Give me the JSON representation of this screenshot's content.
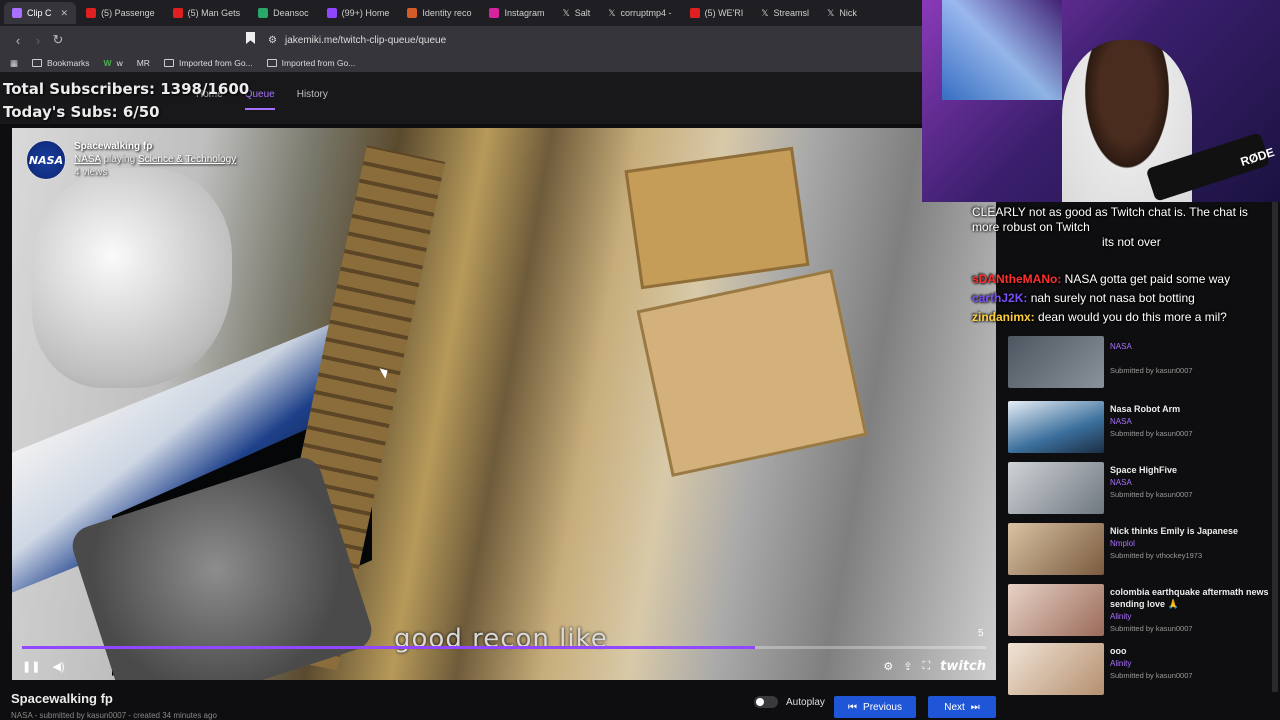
{
  "browser": {
    "tabs": [
      {
        "label": "Clip C",
        "color": "#a970ff",
        "active": true
      },
      {
        "label": "(5) Passenge",
        "color": "#e02020"
      },
      {
        "label": "(5) Man Gets",
        "color": "#e02020"
      },
      {
        "label": "Deansoc",
        "color": "#2aa86b"
      },
      {
        "label": "(99+) Home",
        "color": "#9146ff"
      },
      {
        "label": "Identity reco",
        "color": "#d45d2a"
      },
      {
        "label": "Instagram",
        "color": "#d6249f"
      },
      {
        "label": "Salt",
        "color": "#ffffff"
      },
      {
        "label": "corruptmp4 -",
        "color": "#ffffff"
      },
      {
        "label": "(5) WE'RI",
        "color": "#e02020"
      },
      {
        "label": "Streamsl",
        "color": "#ffffff"
      },
      {
        "label": "Nick",
        "color": "#ffffff"
      }
    ],
    "url": "jakemiki.me/twitch-clip-queue/queue",
    "bookmarks": [
      "Bookmarks",
      "w",
      "MR",
      "Imported from Go...",
      "Imported from Go..."
    ]
  },
  "overlay": {
    "total_subs": "Total Subscribers: 1398/1600",
    "today_subs": "Today's Subs: 6/50"
  },
  "site": {
    "nav": [
      "Home",
      "Queue",
      "History"
    ]
  },
  "player": {
    "clip_title": "Spacewalking fp",
    "channel": "NASA",
    "playing_word": "playing",
    "category": "Science & Technology",
    "views": "4 views",
    "caption": "good recon like",
    "badge": "5",
    "progress": 0.76,
    "twitch": "twitch"
  },
  "bottom": {
    "title": "Spacewalking fp",
    "sub": "NASA - submitted by kasun0007 - created 34 minutes ago",
    "autoplay": "Autoplay",
    "previous": "Previous",
    "next": "Next"
  },
  "queue": [
    {
      "title": "",
      "channel": "NASA",
      "by": "Submitted by kasun0007"
    },
    {
      "title": "Nasa Robot Arm",
      "channel": "NASA",
      "by": "Submitted by kasun0007"
    },
    {
      "title": "Space HighFive",
      "channel": "NASA",
      "by": "Submitted by kasun0007"
    },
    {
      "title": "Nick thinks Emily is Japanese",
      "channel": "Nmplol",
      "by": "Submitted by vthockey1973"
    },
    {
      "title": "colombia earthquake aftermath news sending love 🙏",
      "channel": "Alinity",
      "by": "Submitted by kasun0007"
    },
    {
      "title": "ooo",
      "channel": "Alinity",
      "by": "Submitted by kasun0007"
    }
  ],
  "chat": [
    {
      "user": "",
      "text": "CLEARLY not as good as Twitch chat is. The chat is more robust on Twitch",
      "color": "#ffffff"
    },
    {
      "user": "",
      "text": "its not over",
      "color": "#ffffff"
    },
    {
      "user": "sDANtheMANo:",
      "text": "NASA gotta get paid some way",
      "color": "#ff2f2f"
    },
    {
      "user": "carthJ2K:",
      "text": "nah surely not nasa bot botting",
      "color": "#7a4dff"
    },
    {
      "user": "zindanimx:",
      "text": "dean would you do this more a mil?",
      "color": "#ffcf3a"
    }
  ]
}
